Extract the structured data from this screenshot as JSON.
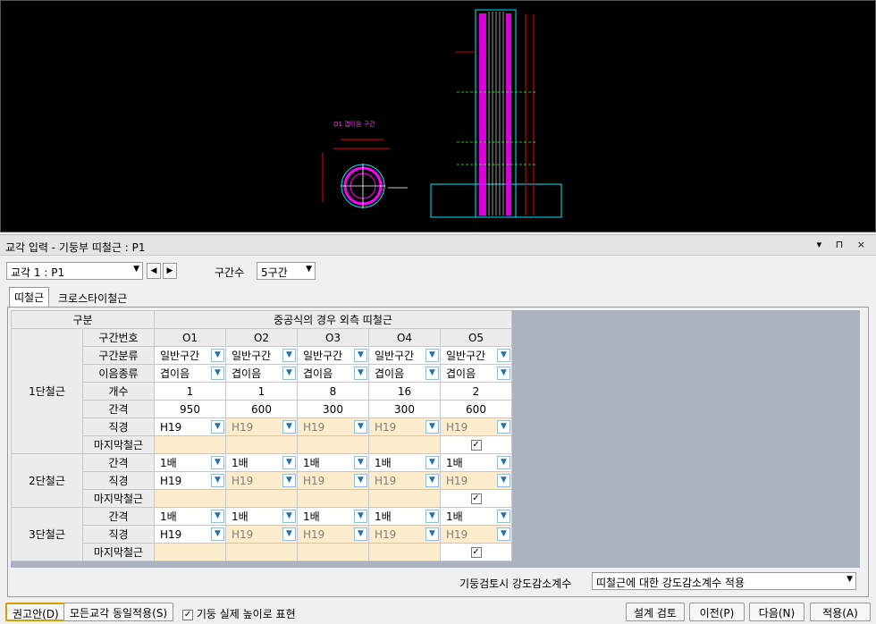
{
  "drawing": {
    "section_label": "O1 겹이음 구간"
  },
  "panel": {
    "title": "교각 입력 - 기둥부 띠철근 : P1",
    "controls": "▾ ⊓ ×"
  },
  "pier_select": {
    "value": "교각 1 : P1"
  },
  "section_count": {
    "label": "구간수",
    "value": "5구간"
  },
  "tabs": [
    "띠철근",
    "크로스타이철근"
  ],
  "grid": {
    "header_left": "구분",
    "header_right": "중공식의 경우 외측 띠철근",
    "sections_label": "구간번호",
    "sections": [
      "O1",
      "O2",
      "O3",
      "O4",
      "O5"
    ],
    "row_labels": {
      "kind": "구간분류",
      "splice": "이음종류",
      "count": "개수",
      "spacing": "간격",
      "dia": "직경",
      "last": "마지막철근"
    },
    "groups": [
      "1단철근",
      "2단철근",
      "3단철근"
    ],
    "kind": [
      "일반구간",
      "일반구간",
      "일반구간",
      "일반구간",
      "일반구간"
    ],
    "splice": [
      "겹이음",
      "겹이음",
      "겹이음",
      "겹이음",
      "겹이음"
    ],
    "count": [
      "1",
      "1",
      "8",
      "16",
      "2"
    ],
    "spacing1": [
      "950",
      "600",
      "300",
      "300",
      "600"
    ],
    "dia": [
      "H19",
      "H19",
      "H19",
      "H19",
      "H19"
    ],
    "mult": [
      "1배",
      "1배",
      "1배",
      "1배",
      "1배"
    ],
    "check_mark": "✓"
  },
  "reduction": {
    "label": "기둥검토시 강도감소계수",
    "value": "띠철근에 대한 강도감소계수 적용"
  },
  "footer": {
    "recommend": "권고안(D)",
    "apply_all": "모든교각 동일적용(S)",
    "actual_height_label": "기둥 실제 높이로 표현",
    "design_check": "설계 검토",
    "prev": "이전(P)",
    "next": "다음(N)",
    "apply": "적용(A)"
  }
}
